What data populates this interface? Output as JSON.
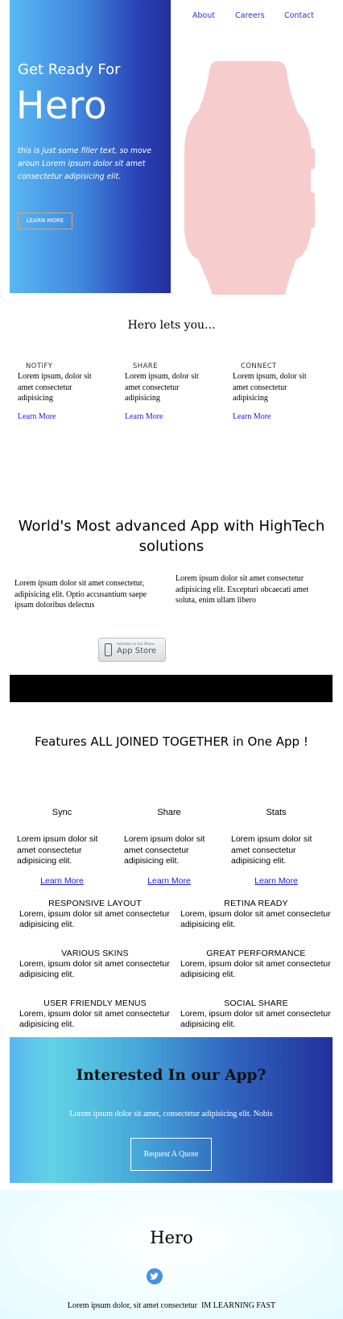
{
  "nav": {
    "links": [
      "About",
      "Careers",
      "Contact"
    ]
  },
  "hero": {
    "small_title": "Get Ready For",
    "big_title": "Hero",
    "description": "this is just some filler text, so move aroun Lorem ipsum dolor sit amet consectetur adipisicing elit.",
    "button": "LEARN MORE",
    "watch_color": "#f7cccc",
    "gradient": [
      "#5ab8f3",
      "#22309c"
    ]
  },
  "lets": {
    "title": "Hero lets you...",
    "items": [
      {
        "heading": "NOTIFY",
        "body": "Lorem ipsum, dolor sit amet consectetur adipisicing",
        "link": "Learn More"
      },
      {
        "heading": "SHARE",
        "body": "Lorem ipsum, dolor sit amet consectetur adipisicing",
        "link": "Learn More"
      },
      {
        "heading": "CONNECT",
        "body": "Lorem ipsum, dolor sit amet consectetur adipisicing",
        "link": "Learn More"
      }
    ]
  },
  "advanced": {
    "title": "World's Most advanced App with HighTech solutions",
    "left": "Lorem ipsum dolor sit amet consectetur, adipisicing elit. Optio accusantium saepe ipsam doloribus delectus",
    "right": "Lorem ipsum dolor sit amet consectetur adipisicing elit. Excepturi obcaecati amet soluta, enim ullam libero",
    "appstore_small": "Available on the iPhone",
    "appstore_big": "App Store"
  },
  "features": {
    "title": "Features ALL JOINED TOGETHER in One App !",
    "columns": [
      {
        "heading": "Sync",
        "body": "Lorem ipsum dolor sit amet consectetur adipisicing elit.",
        "link": "Learn More"
      },
      {
        "heading": "Share",
        "body": "Lorem ipsum dolor sit amet consectetur adipisicing elit.",
        "link": "Learn More"
      },
      {
        "heading": "Stats",
        "body": "Lorem ipsum dolor sit amet consectetur adipisicing elit.",
        "link": "Learn More"
      }
    ],
    "grid": [
      {
        "heading": "RESPONSIVE LAYOUT",
        "body": "Lorem, ipsum dolor sit amet consectetur adipisicing elit."
      },
      {
        "heading": "RETINA READY",
        "body": "Lorem, ipsum dolor sit amet consectetur adipisicing elit."
      },
      {
        "heading": "VARIOUS SKINS",
        "body": "Lorem, ipsum dolor sit amet consectetur adipisicing elit."
      },
      {
        "heading": "GREAT PERFORMANCE",
        "body": "Lorem, ipsum dolor sit amet consectetur adipisicing elit."
      },
      {
        "heading": "USER FRIENDLY MENUS",
        "body": "Lorem, ipsum dolor sit amet consectetur adipisicing elit."
      },
      {
        "heading": "SOCIAL SHARE",
        "body": "Lorem, ipsum dolor sit amet consectetur adipisicing elit."
      }
    ]
  },
  "cta": {
    "title": "Interested In our App?",
    "subtitle": "Lorem ipsum dolor sit amet, consectetur adipisicing elit. Nobis",
    "button": "Request A Quote"
  },
  "footer": {
    "title": "Hero",
    "text": "Lorem ipsum dolor, sit amet consectetur  IM LEARNING FAST",
    "social_icon": "twitter-icon",
    "social_color": "#4a90e2"
  }
}
